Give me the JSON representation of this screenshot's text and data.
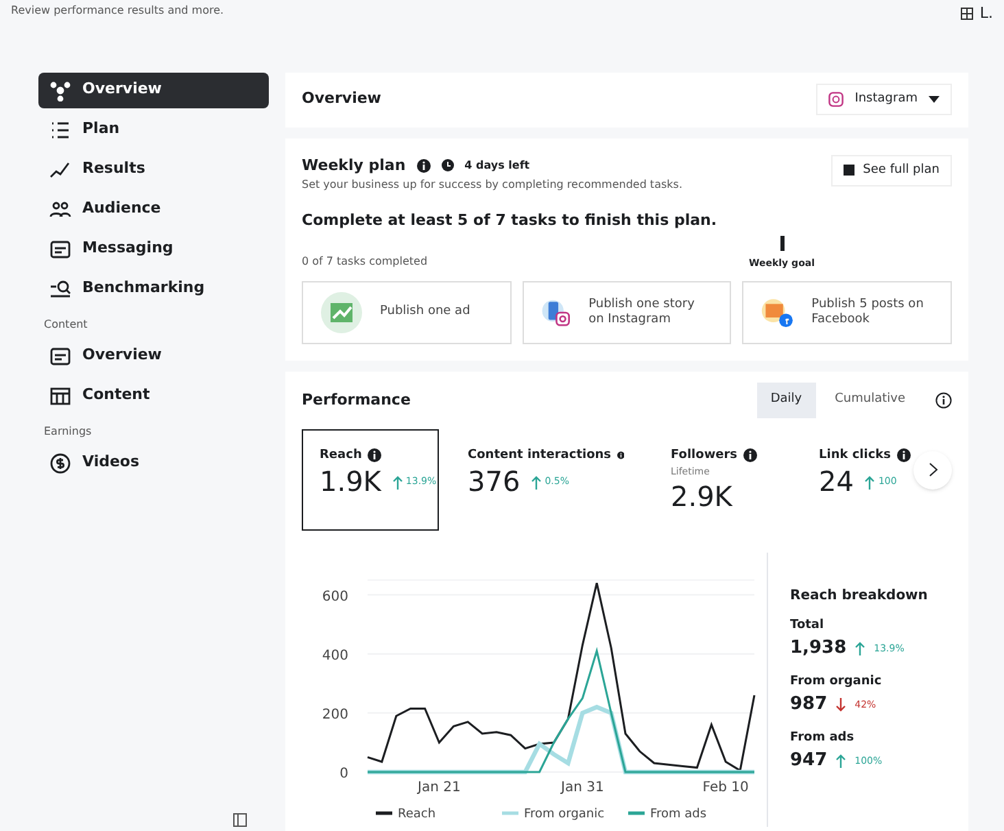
{
  "header": {
    "subtitle": "Review performance results and more.",
    "account": "L."
  },
  "sidebar": {
    "items": [
      {
        "kind": "overview",
        "label": "Overview",
        "selected": true
      },
      {
        "kind": "plan",
        "label": "Plan",
        "selected": false
      },
      {
        "kind": "results",
        "label": "Results",
        "selected": false
      },
      {
        "kind": "audience",
        "label": "Audience",
        "selected": false
      },
      {
        "kind": "messaging",
        "label": "Messaging",
        "selected": false
      },
      {
        "kind": "benchmark",
        "label": "Benchmarking",
        "selected": false
      },
      {
        "kind": "heading",
        "label": "Content"
      },
      {
        "kind": "messaging",
        "label": "Overview",
        "selected": false
      },
      {
        "kind": "table",
        "label": "Content",
        "selected": false
      },
      {
        "kind": "heading",
        "label": "Earnings"
      },
      {
        "kind": "dollar",
        "label": "Videos",
        "selected": false
      }
    ]
  },
  "overview": {
    "title": "Overview",
    "platform": "Instagram"
  },
  "weekly_plan": {
    "title": "Weekly plan",
    "days_left": "4 days left",
    "button": "See full plan",
    "description": "Set your business up for success by completing recommended tasks.",
    "goal_text": "Complete at least 5 of 7 tasks to finish this plan.",
    "progress_text": "0 of 7 tasks completed",
    "goal_label": "Weekly goal",
    "tasks": [
      {
        "kind": "ad",
        "label": "Publish one ad"
      },
      {
        "kind": "story",
        "label": "Publish one story on Instagram"
      },
      {
        "kind": "posts",
        "label": "Publish 5 posts on Facebook"
      }
    ]
  },
  "performance": {
    "title": "Performance",
    "tabs": [
      {
        "label": "Daily",
        "selected": true
      },
      {
        "label": "Cumulative",
        "selected": false
      }
    ],
    "metrics": [
      {
        "label": "Reach",
        "value": "1.9K",
        "change": "13.9%",
        "selected": true
      },
      {
        "label": "Content interactions",
        "value": "376",
        "change": "0.5%",
        "selected": false
      },
      {
        "label": "Followers",
        "sublabel": "Lifetime",
        "value": "2.9K",
        "selected": false
      },
      {
        "label": "Link clicks",
        "value": "24",
        "change": "100",
        "selected": false
      }
    ],
    "chart_data": {
      "type": "line",
      "categories": [
        null,
        null,
        null,
        null,
        null,
        "Jan 21",
        null,
        null,
        null,
        null,
        null,
        null,
        null,
        null,
        null,
        "Jan 31",
        null,
        null,
        null,
        null,
        null,
        null,
        null,
        null,
        null,
        "Feb 10",
        null,
        null
      ],
      "yticks": [
        0,
        200,
        400,
        600
      ],
      "ylim": [
        0,
        650
      ],
      "grid": true,
      "legend": "bottom",
      "series": [
        {
          "name": "Reach",
          "color": "#1c1e21",
          "values": [
            50,
            35,
            190,
            215,
            215,
            100,
            155,
            170,
            130,
            135,
            125,
            80,
            95,
            100,
            180,
            430,
            640,
            420,
            130,
            70,
            30,
            25,
            20,
            15,
            160,
            35,
            5,
            260
          ]
        },
        {
          "name": "From organic",
          "color": "#a6dde3",
          "values": [
            0,
            0,
            0,
            0,
            0,
            0,
            0,
            0,
            0,
            0,
            0,
            0,
            95,
            60,
            30,
            200,
            220,
            200,
            0,
            0,
            0,
            0,
            0,
            0,
            0,
            0,
            0,
            0
          ]
        },
        {
          "name": "From ads",
          "color": "#2ba596",
          "values": [
            0,
            0,
            0,
            0,
            0,
            0,
            0,
            0,
            0,
            0,
            0,
            0,
            0,
            100,
            180,
            250,
            410,
            200,
            0,
            0,
            0,
            0,
            0,
            0,
            0,
            0,
            0,
            0
          ]
        }
      ]
    },
    "breakdown": {
      "title": "Reach breakdown",
      "items": [
        {
          "label": "Total",
          "value": "1,938",
          "change": "13.9%",
          "kind": "up"
        },
        {
          "label": "From organic",
          "value": "987",
          "change": "42%",
          "kind": "down"
        },
        {
          "label": "From ads",
          "value": "947",
          "change": "100%",
          "kind": "up"
        }
      ]
    }
  }
}
